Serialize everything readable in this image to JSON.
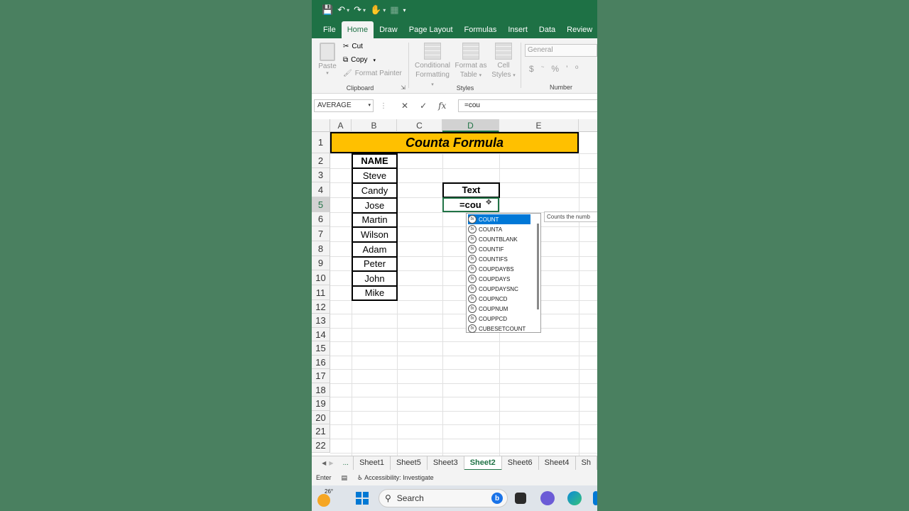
{
  "titlebar": {
    "save_icon": "save-icon",
    "undo_icon": "undo-icon",
    "redo_icon": "redo-icon",
    "touch_icon": "touch-mode-icon",
    "form_icon": "form-icon",
    "customize_icon": "customize-qat-icon"
  },
  "tabs": [
    "File",
    "Home",
    "Draw",
    "Page Layout",
    "Formulas",
    "Insert",
    "Data",
    "Review"
  ],
  "active_tab": "Home",
  "ribbon": {
    "paste_label": "Paste",
    "cut_label": "Cut",
    "copy_label": "Copy",
    "format_painter_label": "Format Painter",
    "clipboard_group": "Clipboard",
    "conditional_formatting": [
      "Conditional",
      "Formatting"
    ],
    "format_as_table": [
      "Format as",
      "Table"
    ],
    "cell_styles": [
      "Cell",
      "Styles"
    ],
    "styles_group": "Styles",
    "number_format": "General",
    "number_symbols": [
      "$",
      "~",
      "%",
      "’",
      "⁰"
    ],
    "number_group": "Number"
  },
  "formula_bar": {
    "name_box": "AVERAGE",
    "cancel_symbol": "✕",
    "enter_symbol": "✓",
    "fx_symbol": "fx",
    "formula": "=cou"
  },
  "grid": {
    "columns": [
      "A",
      "B",
      "C",
      "D",
      "E"
    ],
    "rows": [
      "1",
      "2",
      "3",
      "4",
      "5",
      "6",
      "7",
      "8",
      "9",
      "10",
      "11",
      "12",
      "13",
      "14",
      "15",
      "16",
      "17",
      "18",
      "19",
      "20",
      "21",
      "22"
    ],
    "title": "Counta Formula",
    "name_header": "NAME",
    "names": [
      "Steve",
      "Candy",
      "Jose",
      "Martin",
      "Wilson",
      "Adam",
      "Peter",
      "John",
      "Mike"
    ],
    "text_header": "Text",
    "active_cell_value": "=cou"
  },
  "autocomplete": {
    "items": [
      "COUNT",
      "COUNTA",
      "COUNTBLANK",
      "COUNTIF",
      "COUNTIFS",
      "COUPDAYBS",
      "COUPDAYS",
      "COUPDAYSNC",
      "COUPNCD",
      "COUPNUM",
      "COUPPCD",
      "CUBESETCOUNT"
    ],
    "selected": "COUNT",
    "tooltip": "Counts the numb"
  },
  "sheets": [
    "Sheet1",
    "Sheet5",
    "Sheet3",
    "Sheet2",
    "Sheet6",
    "Sheet4",
    "Sh"
  ],
  "active_sheet": "Sheet2",
  "sheet_more": "...",
  "status": {
    "mode": "Enter",
    "accessibility": "Accessibility: Investigate"
  },
  "taskbar": {
    "temperature": "26°",
    "search_label": "Search"
  },
  "colors": {
    "excel_green": "#1e7145",
    "title_fill": "#ffc000",
    "selection_blue": "#0078d7"
  }
}
